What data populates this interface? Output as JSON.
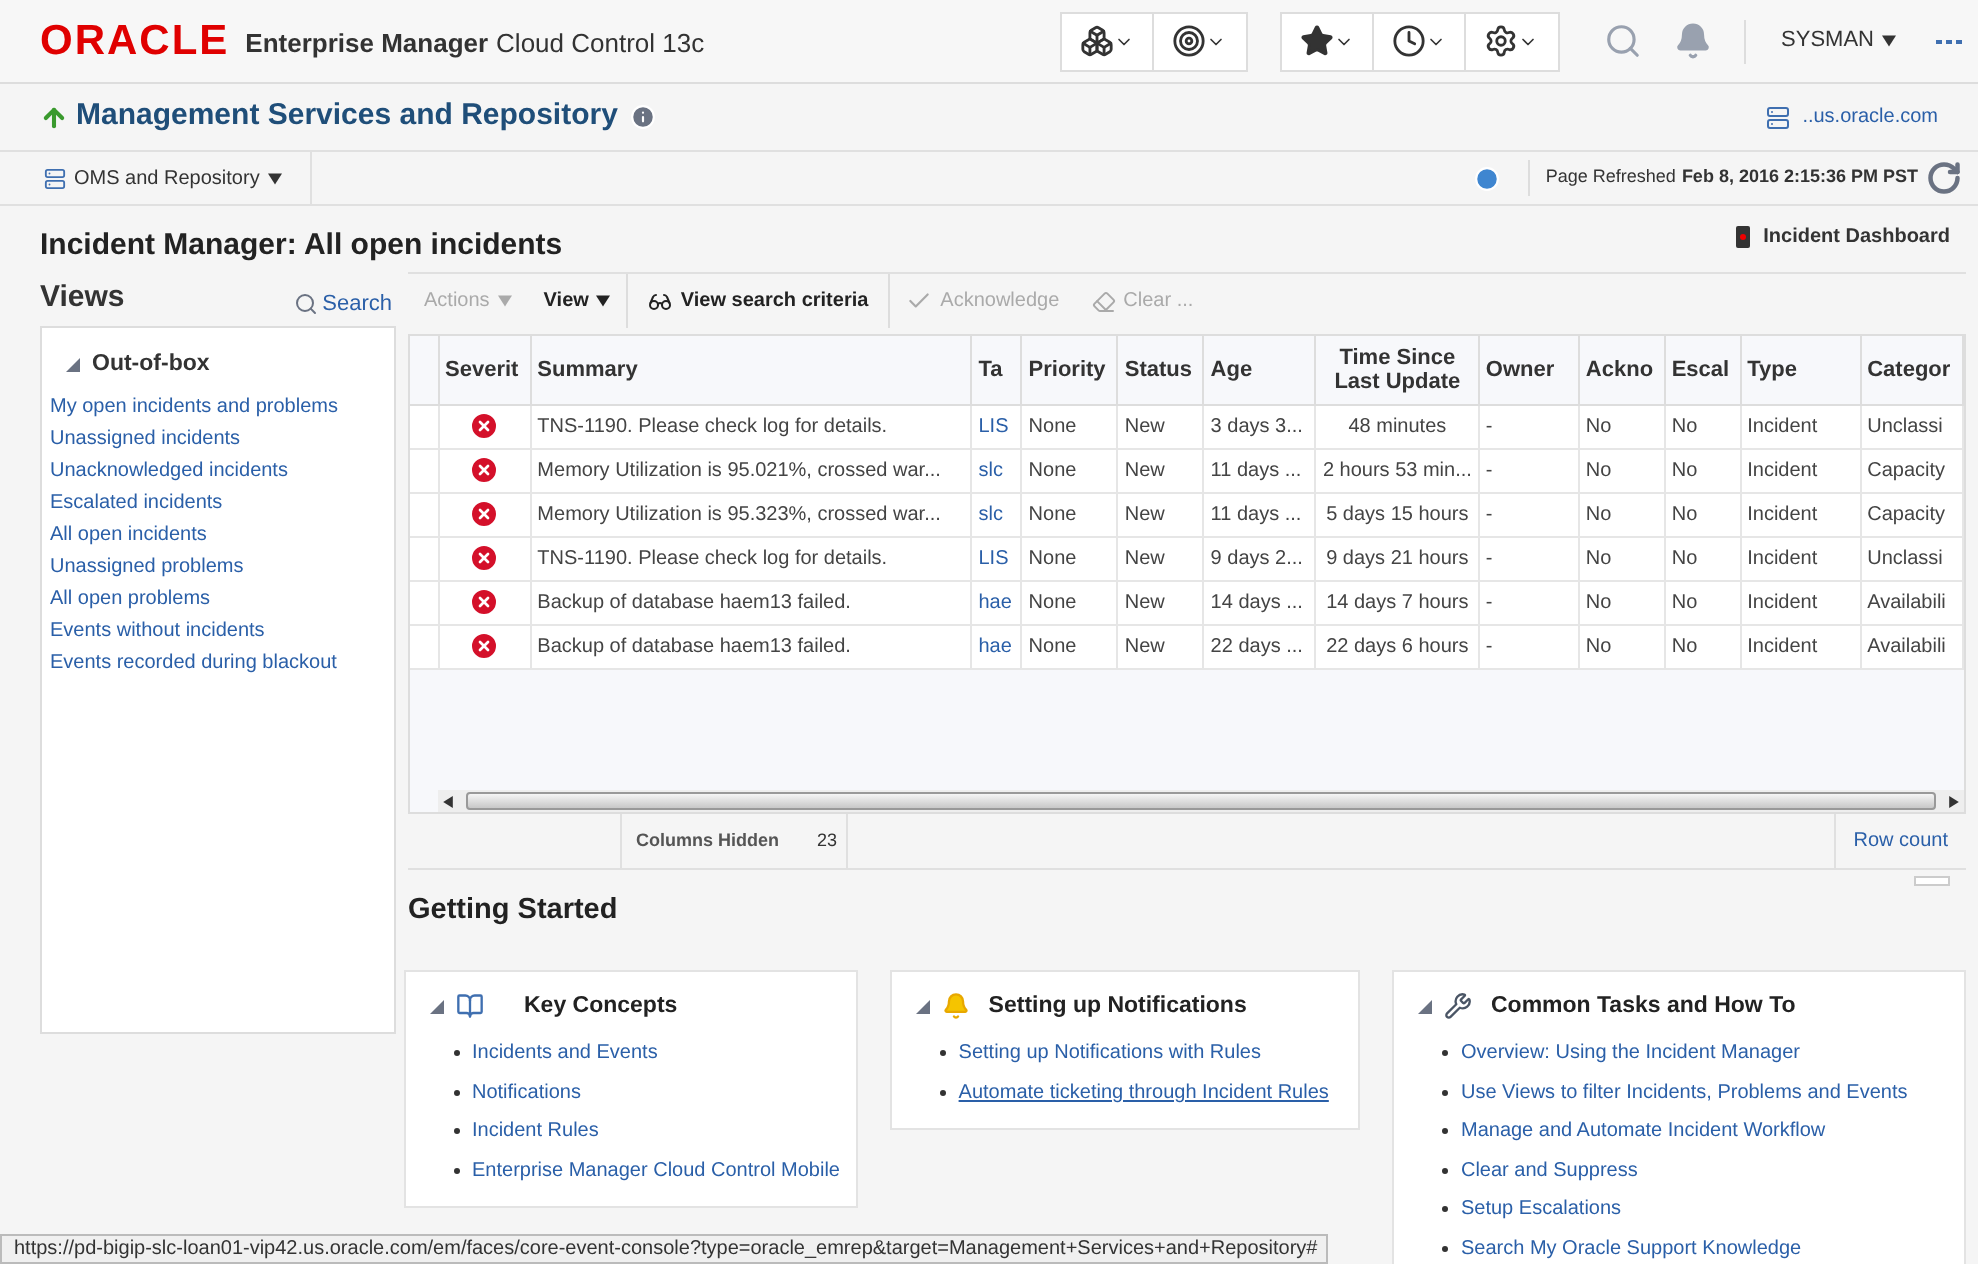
{
  "header": {
    "logo": "ORACLE",
    "product": "Enterprise Manager",
    "edition": "Cloud Control 13c",
    "user": "SYSMAN"
  },
  "target": {
    "title": "Management Services and Repository",
    "host": "..us.oracle.com",
    "menu": "OMS and Repository",
    "refreshed_label": "Page Refreshed",
    "refreshed_time": "Feb 8, 2016 2:15:36 PM PST"
  },
  "page": {
    "title": "Incident Manager: All open incidents",
    "dashboard": "Incident Dashboard"
  },
  "views": {
    "title": "Views",
    "search": "Search",
    "group": "Out-of-box",
    "expanded": true,
    "items": [
      "My open incidents and problems",
      "Unassigned incidents",
      "Unacknowledged incidents",
      "Escalated incidents",
      "All open incidents",
      "Unassigned problems",
      "All open problems",
      "Events without incidents",
      "Events recorded during blackout"
    ]
  },
  "toolbar": [
    {
      "label": "Actions",
      "kind": "menu",
      "disabled": true
    },
    {
      "label": "View",
      "kind": "menu",
      "disabled": false
    },
    {
      "label": "View search criteria",
      "kind": "glasses",
      "disabled": false
    },
    {
      "label": "Acknowledge",
      "kind": "check",
      "disabled": true
    },
    {
      "label": "Clear ...",
      "kind": "eraser",
      "disabled": true
    }
  ],
  "table": {
    "severity_column": "Severit",
    "columns": [
      "Summary",
      "Ta",
      "Priority",
      "Status",
      "Age",
      "Time Since Last Update",
      "Owner",
      "Ackno",
      "Escal",
      "Type",
      "Categor"
    ],
    "rows": [
      {
        "kind": "critical",
        "cells": [
          "TNS-1190. Please check log for details.",
          "LIS",
          "None",
          "New",
          "3 days 3...",
          "48 minutes",
          "-",
          "No",
          "No",
          "Incident",
          "Unclassi"
        ]
      },
      {
        "kind": "critical",
        "cells": [
          "Memory Utilization is 95.021%, crossed war...",
          "slc",
          "None",
          "New",
          "11 days ...",
          "2 hours 53 min...",
          "-",
          "No",
          "No",
          "Incident",
          "Capacity"
        ]
      },
      {
        "kind": "critical",
        "cells": [
          "Memory Utilization is 95.323%, crossed war...",
          "slc",
          "None",
          "New",
          "11 days ...",
          "5 days 15 hours",
          "-",
          "No",
          "No",
          "Incident",
          "Capacity"
        ]
      },
      {
        "kind": "critical",
        "cells": [
          "TNS-1190. Please check log for details.",
          "LIS",
          "None",
          "New",
          "9 days 2...",
          "9 days 21 hours",
          "-",
          "No",
          "No",
          "Incident",
          "Unclassi"
        ]
      },
      {
        "kind": "critical",
        "cells": [
          "Backup of database haem13 failed.",
          "hae",
          "None",
          "New",
          "14 days ...",
          "14 days 7 hours",
          "-",
          "No",
          "No",
          "Incident",
          "Availabili"
        ]
      },
      {
        "kind": "critical",
        "cells": [
          "Backup of database haem13 failed.",
          "hae",
          "None",
          "New",
          "22 days ...",
          "22 days 6 hours",
          "-",
          "No",
          "No",
          "Incident",
          "Availabili"
        ]
      }
    ],
    "columns_hidden_label": "Columns Hidden",
    "columns_hidden": "23",
    "row_count": "Row count"
  },
  "getting_started": {
    "title": "Getting Started",
    "cards": [
      {
        "title": "Key Concepts",
        "kind": "book",
        "links": [
          "Incidents and Events",
          "Notifications",
          "Incident Rules",
          "Enterprise Manager Cloud Control Mobile"
        ]
      },
      {
        "title": "Setting up Notifications",
        "kind": "bell",
        "links": [
          "Setting up Notifications with Rules",
          "Automate ticketing through Incident Rules"
        ]
      },
      {
        "title": "Common Tasks and How To",
        "kind": "wrench",
        "links": [
          "Overview: Using the Incident Manager",
          "Use Views to filter Incidents, Problems and Events",
          "Manage and Automate Incident Workflow",
          "Clear and Suppress",
          "Setup Escalations",
          "Search My Oracle Support Knowledge"
        ]
      }
    ]
  },
  "status_bar": "https://pd-bigip-slc-loan01-vip42.us.oracle.com/em/faces/core-event-console?type=oracle_emrep&target=Management+Services+and+Repository#"
}
